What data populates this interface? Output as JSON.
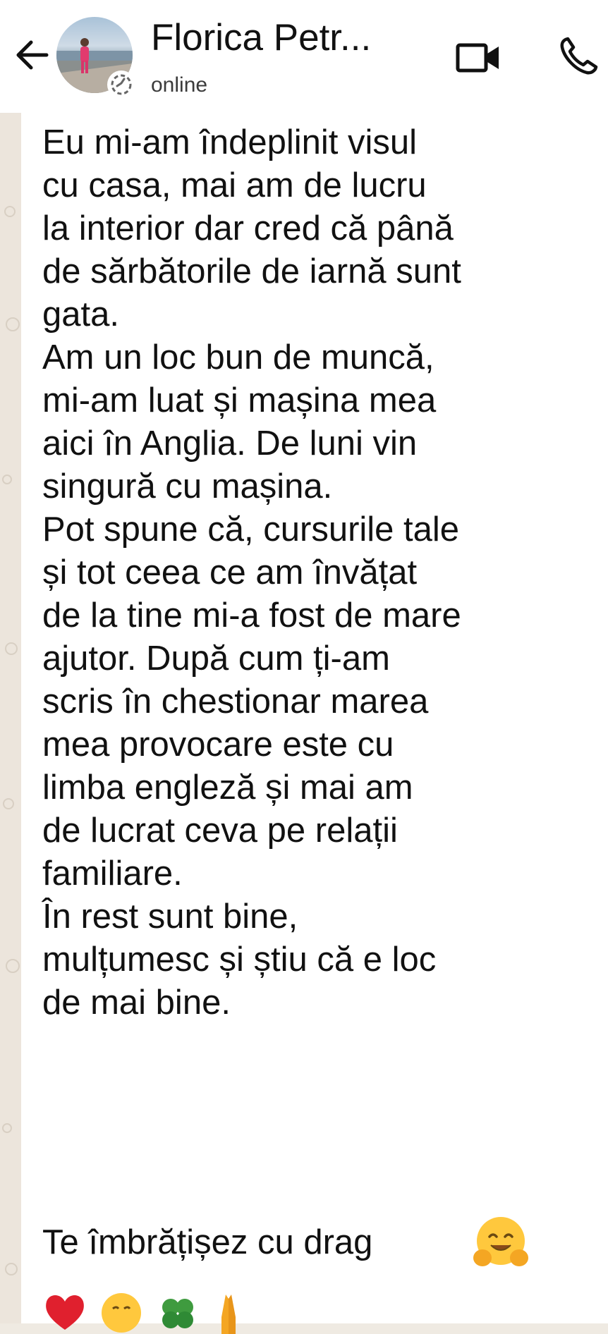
{
  "header": {
    "contact_name": "Florica Petr...",
    "status": "online"
  },
  "message": {
    "body": "Eu mi-am îndeplinit visul\ncu casa,  mai am de lucru\nla interior dar cred că până\nde sărbătorile de iarnă sunt\ngata.\nAm un loc bun de muncă,\nmi-am luat și mașina mea\naici în Anglia.  De luni vin\nsingură cu mașina.\nPot spune că, cursurile tale\nși tot ceea ce am învățat\nde la tine mi-a fost de mare\najutor. După cum ți-am\nscris în chestionar marea\nmea provocare este cu\nlimba engleză și mai am\nde lucrat ceva pe relații\nfamiliare.\nÎn rest sunt bine,\nmulțumesc și știu că e loc\nde mai bine.",
    "closing": "Te îmbrățișez cu drag"
  },
  "icons": {
    "back": "arrow-left-icon",
    "video": "video-camera-icon",
    "call": "phone-icon",
    "hug_emoji": "hugging-face-emoji",
    "row_emojis": [
      "red-heart-emoji",
      "smiling-face-emoji",
      "four-leaf-clover-emoji",
      "folded-hands-emoji"
    ]
  },
  "colors": {
    "header_bg": "#ffffff",
    "bubble_bg": "#ffffff",
    "text": "#111111",
    "status_text": "#3b3b3b"
  }
}
